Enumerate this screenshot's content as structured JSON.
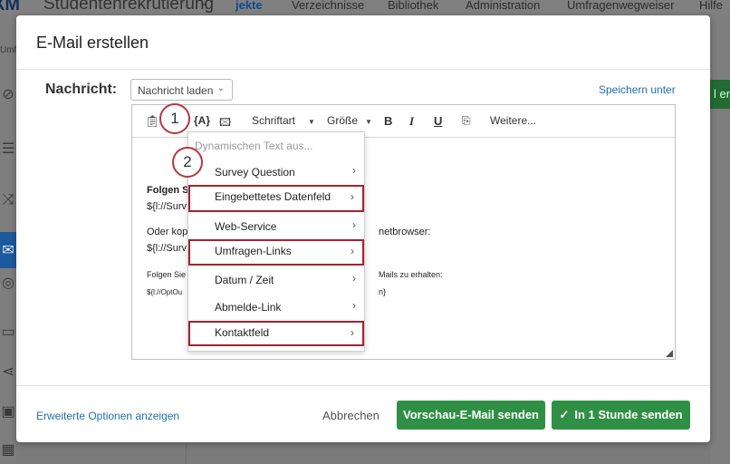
{
  "background": {
    "logo": "XM",
    "project_title": "Studentenrekrutierung",
    "nav": [
      "jekte",
      "Verzeichnisse",
      "Bibliothek",
      "Administration",
      "Umfragenwegweiser",
      "Hilfe"
    ],
    "left_partial": "Umf",
    "right_partial": "l ers"
  },
  "modal": {
    "title": "E-Mail erstellen",
    "message_label": "Nachricht:",
    "load_message": "Nachricht laden",
    "save_under": "Speichern unter",
    "toolbar": {
      "dyn_text": "{A}",
      "font": "Schriftart",
      "size": "Größe",
      "bold": "B",
      "italic": "I",
      "underline": "U",
      "more": "Weitere..."
    },
    "body_lines": {
      "l1": "Folgen S",
      "l2": "${l://Surv",
      "l3": "Oder kop",
      "l3b": "netbrowser:",
      "l4": "${l://Surv",
      "l5": "Folgen Sie",
      "l5b": "Mails zu erhalten:",
      "l6": "${l://OptOu",
      "l6b": "n}"
    },
    "menu": {
      "header": "Dynamischen Text aus...",
      "items": [
        {
          "label": "Survey Question"
        },
        {
          "label": "Eingebettetes Datenfeld"
        },
        {
          "label": "Web-Service"
        },
        {
          "label": "Umfragen-Links"
        },
        {
          "label": "Datum / Zeit"
        },
        {
          "label": "Abmelde-Link"
        },
        {
          "label": "Kontaktfeld"
        }
      ],
      "arrow": "›"
    },
    "steps": [
      "1",
      "2"
    ],
    "footer": {
      "advanced": "Erweiterte Optionen anzeigen",
      "cancel": "Abbrechen",
      "preview": "Vorschau-E-Mail senden",
      "send": "In 1 Stunde senden"
    }
  },
  "colors": {
    "accent_green": "#2f8f44",
    "link_blue": "#1f6fb2",
    "highlight_red": "#a3232f"
  }
}
